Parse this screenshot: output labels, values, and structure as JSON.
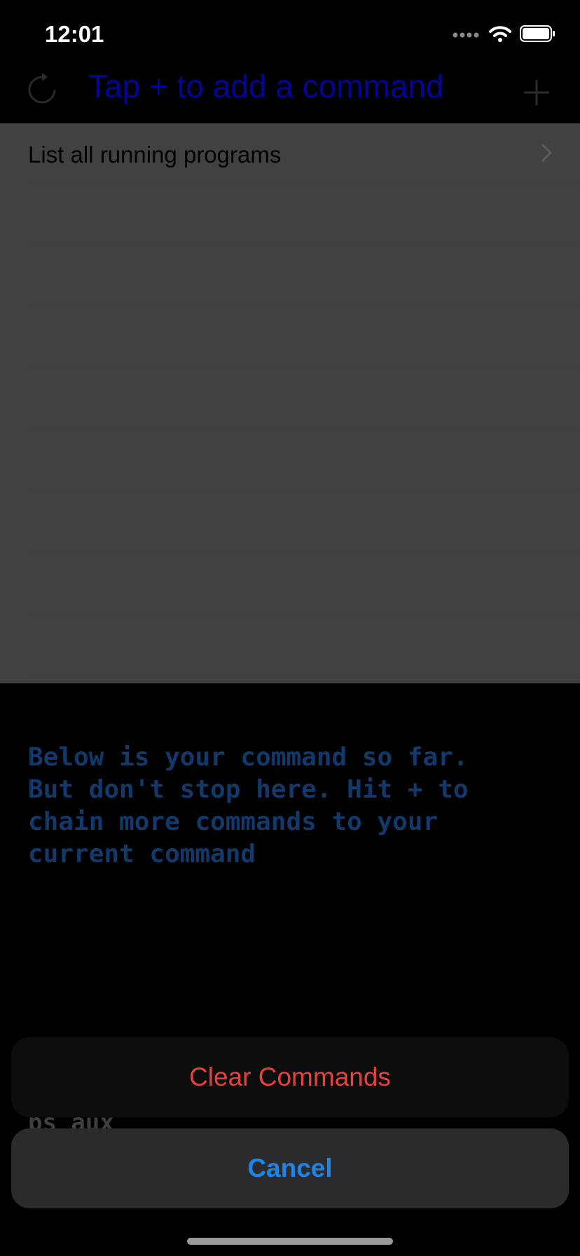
{
  "status": {
    "time": "12:01"
  },
  "nav": {
    "title": "Tap + to add a command",
    "refresh_icon": "refresh-icon",
    "add_icon": "plus-icon"
  },
  "list": {
    "items": [
      {
        "label": "List all running programs"
      }
    ]
  },
  "description": "Below is your command so far.\nBut don't stop here. Hit + to\nchain more commands to your\ncurrent command",
  "command_output": "ps aux",
  "action_sheet": {
    "clear_label": "Clear Commands",
    "cancel_label": "Cancel"
  },
  "colors": {
    "title": "#050595",
    "destructive": "#e2443a",
    "accent": "#1d85ea",
    "separator": "#6b2a2d"
  }
}
